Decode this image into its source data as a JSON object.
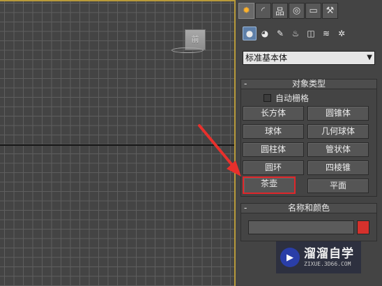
{
  "viewport": {
    "viewcube_label": "前"
  },
  "tabs": [
    {
      "name": "create",
      "glyph": "✹"
    },
    {
      "name": "modify",
      "glyph": "◜"
    },
    {
      "name": "hierarchy",
      "glyph": "品"
    },
    {
      "name": "motion",
      "glyph": "◎"
    },
    {
      "name": "display",
      "glyph": "▭"
    },
    {
      "name": "utilities",
      "glyph": "⚒"
    }
  ],
  "subtabs": [
    {
      "name": "geometry",
      "glyph": "●"
    },
    {
      "name": "shapes",
      "glyph": "◕"
    },
    {
      "name": "lights",
      "glyph": "✎"
    },
    {
      "name": "cameras",
      "glyph": "♨"
    },
    {
      "name": "helpers",
      "glyph": "◫"
    },
    {
      "name": "space-warps",
      "glyph": "≋"
    },
    {
      "name": "systems",
      "glyph": "✲"
    }
  ],
  "dropdown": {
    "selected": "标准基本体",
    "caret": "▼"
  },
  "object_type": {
    "header": "对象类型",
    "collapse": "-",
    "autogrid_label": "自动栅格",
    "buttons": [
      "长方体",
      "圆锥体",
      "球体",
      "几何球体",
      "圆柱体",
      "管状体",
      "圆环",
      "四棱锥",
      "茶壶",
      "平面"
    ]
  },
  "name_color": {
    "header": "名称和颜色",
    "collapse": "-",
    "name_value": "",
    "swatch_color": "#d5312c"
  },
  "watermark": {
    "title": "溜溜自学",
    "subtitle": "ZIXUE.3D66.COM"
  },
  "colors": {
    "highlight": "#e0262a",
    "active_tab": "#ffb22a"
  }
}
